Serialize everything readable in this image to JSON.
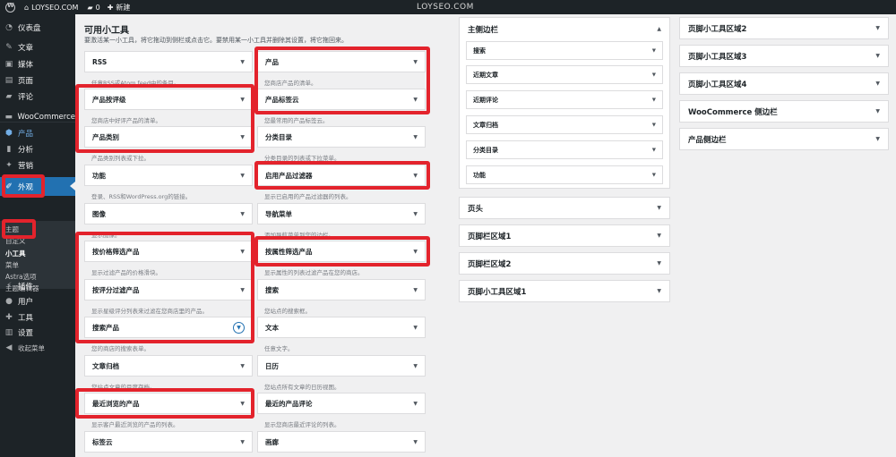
{
  "adminbar": {
    "site_name": "LOYSEO.COM",
    "comments_count": "0",
    "new_label": "新建"
  },
  "watermark": "LOYSEO.COM",
  "sidebar": {
    "items": [
      {
        "label": "仪表盘",
        "icon": "dashboard-icon",
        "glyph": "◔"
      },
      {
        "label": "文章",
        "icon": "pin-icon",
        "glyph": "✎"
      },
      {
        "label": "媒体",
        "icon": "media-icon",
        "glyph": "▣"
      },
      {
        "label": "页面",
        "icon": "page-icon",
        "glyph": "▤"
      },
      {
        "label": "评论",
        "icon": "comment-icon",
        "glyph": "▰"
      },
      {
        "label": "WooCommerce",
        "icon": "woo-icon",
        "glyph": "▬"
      },
      {
        "label": "产品",
        "icon": "product-icon",
        "glyph": "⬢"
      },
      {
        "label": "分析",
        "icon": "analytics-icon",
        "glyph": "▮"
      },
      {
        "label": "营销",
        "icon": "marketing-icon",
        "glyph": "✦"
      },
      {
        "label": "外观",
        "icon": "brush-icon",
        "glyph": "✐"
      },
      {
        "label": "插件",
        "icon": "plugin-icon",
        "glyph": "⚡"
      },
      {
        "label": "用户",
        "icon": "user-icon",
        "glyph": "●"
      },
      {
        "label": "工具",
        "icon": "wrench-icon",
        "glyph": "✚"
      },
      {
        "label": "设置",
        "icon": "settings-icon",
        "glyph": "▥"
      },
      {
        "label": "收起菜单",
        "icon": "collapse-icon",
        "glyph": "◀"
      }
    ],
    "submenu": [
      "主题",
      "自定义",
      "小工具",
      "菜单",
      "Astra选项",
      "主题编辑器"
    ]
  },
  "widgets_section": {
    "title": "可用小工具",
    "description": "要激活某一小工具，将它拖动到侧栏或点击它。要禁用某一小工具并删除其设置，将它拖回来。"
  },
  "widgets": [
    {
      "title": "RSS",
      "desc": "任意RSS或Atom feed中的条目。"
    },
    {
      "title": "产品",
      "desc": "您商店产品的清单。"
    },
    {
      "title": "产品按评级",
      "desc": "您商店中好评产品的清单。"
    },
    {
      "title": "产品标签云",
      "desc": "您最常用的产品标签云。"
    },
    {
      "title": "产品类别",
      "desc": "产品类别列表或下拉。"
    },
    {
      "title": "分类目录",
      "desc": "分类目录的列表或下拉菜单。"
    },
    {
      "title": "功能",
      "desc": "登录、RSS和WordPress.org的链接。"
    },
    {
      "title": "启用产品过滤器",
      "desc": "显示已启用的产品过滤器的列表。"
    },
    {
      "title": "图像",
      "desc": "显示图像。"
    },
    {
      "title": "导航菜单",
      "desc": "添加导航菜单到您的边栏。"
    },
    {
      "title": "按价格筛选产品",
      "desc": "显示过滤产品的价格滑块。"
    },
    {
      "title": "按属性筛选产品",
      "desc": "显示属性的列表过滤产品在您的商店。"
    },
    {
      "title": "按评分过滤产品",
      "desc": "显示星级评分列表来过滤在您商店里的产品。"
    },
    {
      "title": "搜索",
      "desc": "您站点的搜索框。"
    },
    {
      "title": "搜索产品",
      "desc": "您的商店的搜索表单。"
    },
    {
      "title": "文本",
      "desc": "任意文字。"
    },
    {
      "title": "文章归档",
      "desc": "您站点文章的月度存档。"
    },
    {
      "title": "日历",
      "desc": "您站点所有文章的日历视图。"
    },
    {
      "title": "最近浏览的产品",
      "desc": "显示客户最近浏览的产品的列表。"
    },
    {
      "title": "最近的产品评论",
      "desc": "显示您商店最近评论的列表。"
    },
    {
      "title": "标签云",
      "desc": ""
    },
    {
      "title": "画廊",
      "desc": ""
    }
  ],
  "main_sidebar": {
    "title": "主侧边栏",
    "widgets": [
      "搜索",
      "近期文章",
      "近期评论",
      "文章归档",
      "分类目录",
      "功能"
    ]
  },
  "areas_middle": [
    "页头",
    "页脚栏区域1",
    "页脚栏区域2",
    "页脚小工具区域1"
  ],
  "areas_right": [
    "页脚小工具区域2",
    "页脚小工具区域3",
    "页脚小工具区域4",
    "WooCommerce 侧边栏",
    "产品侧边栏"
  ]
}
